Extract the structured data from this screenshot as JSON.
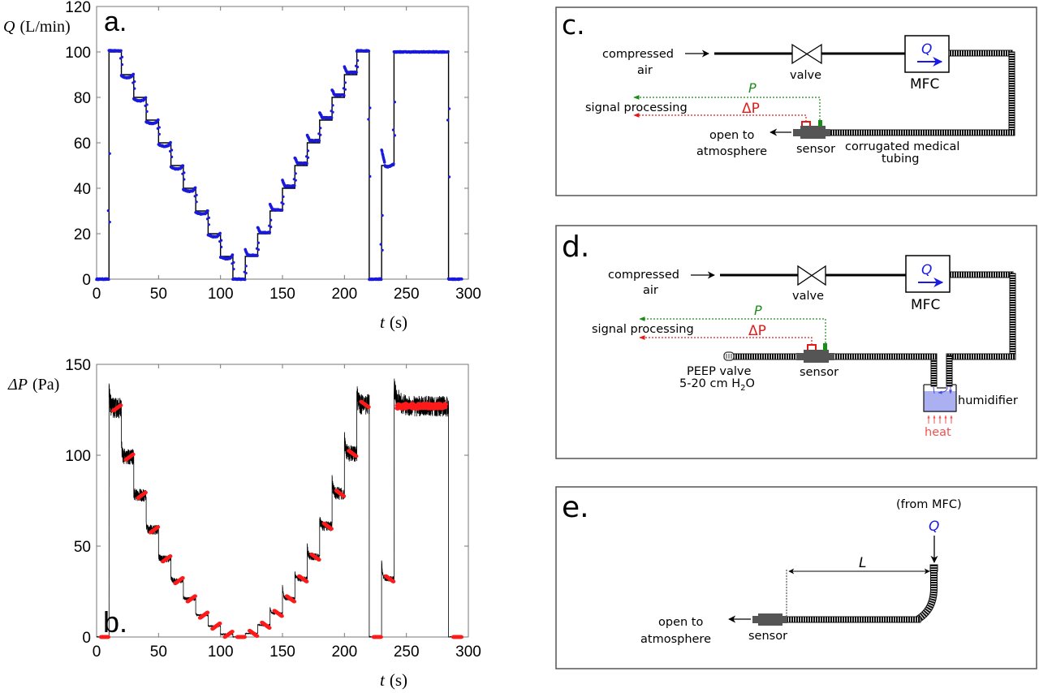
{
  "chart_data": [
    {
      "panel_label": "a.",
      "type": "line",
      "ylabel": "Q (L/min)",
      "ylabel_var": "Q",
      "ylabel_unit": "(L/min)",
      "xlabel_var": "t",
      "xlabel_unit": "(s)",
      "xlim": [
        0,
        300
      ],
      "ylim": [
        0,
        120
      ],
      "xticks": [
        "0",
        "50",
        "100",
        "150",
        "200",
        "250",
        "300"
      ],
      "yticks": [
        "0",
        "20",
        "40",
        "60",
        "80",
        "100",
        "120"
      ],
      "xtick_values": [
        0,
        50,
        100,
        150,
        200,
        250,
        300
      ],
      "ytick_values": [
        0,
        20,
        40,
        60,
        80,
        100,
        120
      ],
      "grid": false,
      "series": [
        {
          "name": "setpoint",
          "color": "#000000",
          "style": "step-line",
          "steps": [
            [
              0,
              0
            ],
            [
              10,
              100
            ],
            [
              20,
              90
            ],
            [
              30,
              80
            ],
            [
              40,
              70
            ],
            [
              50,
              60
            ],
            [
              60,
              50
            ],
            [
              70,
              40
            ],
            [
              80,
              30
            ],
            [
              90,
              20
            ],
            [
              100,
              10
            ],
            [
              110,
              0
            ],
            [
              120,
              10
            ],
            [
              130,
              20
            ],
            [
              140,
              30
            ],
            [
              150,
              40
            ],
            [
              160,
              50
            ],
            [
              170,
              60
            ],
            [
              180,
              70
            ],
            [
              190,
              80
            ],
            [
              200,
              90
            ],
            [
              210,
              100
            ],
            [
              220,
              0
            ],
            [
              230,
              50
            ],
            [
              240,
              100
            ],
            [
              284,
              0
            ],
            [
              295,
              0
            ]
          ]
        },
        {
          "name": "measured",
          "color": "#1a1adc",
          "style": "markers",
          "plateaus": [
            {
              "t0": 0,
              "t1": 10,
              "v": 0
            },
            {
              "t0": 10,
              "t1": 20,
              "v": 100.5
            },
            {
              "t0": 20,
              "t1": 30,
              "v": 89.5
            },
            {
              "t0": 30,
              "t1": 40,
              "v": 79.3
            },
            {
              "t0": 40,
              "t1": 50,
              "v": 69.3
            },
            {
              "t0": 50,
              "t1": 60,
              "v": 59.3
            },
            {
              "t0": 60,
              "t1": 70,
              "v": 49.3
            },
            {
              "t0": 70,
              "t1": 80,
              "v": 39.5
            },
            {
              "t0": 80,
              "t1": 90,
              "v": 29.5
            },
            {
              "t0": 90,
              "t1": 100,
              "v": 19.5
            },
            {
              "t0": 100,
              "t1": 110,
              "v": 9.8
            },
            {
              "t0": 110,
              "t1": 120,
              "v": 0
            },
            {
              "t0": 120,
              "t1": 130,
              "v": 10.5
            },
            {
              "t0": 130,
              "t1": 140,
              "v": 20.5
            },
            {
              "t0": 140,
              "t1": 150,
              "v": 30.5
            },
            {
              "t0": 150,
              "t1": 160,
              "v": 41
            },
            {
              "t0": 160,
              "t1": 170,
              "v": 51
            },
            {
              "t0": 170,
              "t1": 180,
              "v": 61
            },
            {
              "t0": 180,
              "t1": 190,
              "v": 71
            },
            {
              "t0": 190,
              "t1": 200,
              "v": 81
            },
            {
              "t0": 200,
              "t1": 210,
              "v": 91
            },
            {
              "t0": 210,
              "t1": 220,
              "v": 100.5
            },
            {
              "t0": 220,
              "t1": 230,
              "v": 0
            },
            {
              "t0": 230,
              "t1": 240,
              "v": 51
            },
            {
              "t0": 240,
              "t1": 284,
              "v": 100
            },
            {
              "t0": 284,
              "t1": 295,
              "v": 0
            }
          ]
        }
      ]
    },
    {
      "panel_label": "b.",
      "type": "line",
      "ylabel": "ΔP (Pa)",
      "ylabel_var": "ΔP",
      "ylabel_unit": "(Pa)",
      "xlabel_var": "t",
      "xlabel_unit": "(s)",
      "xlim": [
        0,
        300
      ],
      "ylim": [
        0,
        150
      ],
      "xticks": [
        "0",
        "50",
        "100",
        "150",
        "200",
        "250",
        "300"
      ],
      "yticks": [
        "0",
        "50",
        "100",
        "150"
      ],
      "xtick_values": [
        0,
        50,
        100,
        150,
        200,
        250,
        300
      ],
      "ytick_values": [
        0,
        50,
        100,
        150
      ],
      "grid": false,
      "series": [
        {
          "name": "raw",
          "color": "#000000",
          "style": "noisy-line",
          "plateaus": [
            {
              "t0": 0,
              "t1": 10,
              "v": 0,
              "peak": 0
            },
            {
              "t0": 10,
              "t1": 20,
              "v": 126,
              "peak": 137
            },
            {
              "t0": 20,
              "t1": 30,
              "v": 99,
              "peak": 106
            },
            {
              "t0": 30,
              "t1": 40,
              "v": 78,
              "peak": 80
            },
            {
              "t0": 40,
              "t1": 50,
              "v": 59,
              "peak": 62
            },
            {
              "t0": 50,
              "t1": 60,
              "v": 43,
              "peak": 45
            },
            {
              "t0": 60,
              "t1": 70,
              "v": 31,
              "peak": 33
            },
            {
              "t0": 70,
              "t1": 80,
              "v": 21,
              "peak": 22
            },
            {
              "t0": 80,
              "t1": 90,
              "v": 12,
              "peak": 13
            },
            {
              "t0": 90,
              "t1": 100,
              "v": 6,
              "peak": 6
            },
            {
              "t0": 100,
              "t1": 110,
              "v": 1.5,
              "peak": 1.5
            },
            {
              "t0": 110,
              "t1": 120,
              "v": 0,
              "peak": 0
            },
            {
              "t0": 120,
              "t1": 130,
              "v": 2,
              "peak": 2
            },
            {
              "t0": 130,
              "t1": 140,
              "v": 6.5,
              "peak": 7
            },
            {
              "t0": 140,
              "t1": 150,
              "v": 13,
              "peak": 16
            },
            {
              "t0": 150,
              "t1": 160,
              "v": 21,
              "peak": 28
            },
            {
              "t0": 160,
              "t1": 170,
              "v": 32,
              "peak": 35
            },
            {
              "t0": 170,
              "t1": 180,
              "v": 44,
              "peak": 50
            },
            {
              "t0": 180,
              "t1": 190,
              "v": 61,
              "peak": 65
            },
            {
              "t0": 190,
              "t1": 200,
              "v": 79,
              "peak": 88
            },
            {
              "t0": 200,
              "t1": 210,
              "v": 101,
              "peak": 110
            },
            {
              "t0": 210,
              "t1": 220,
              "v": 128,
              "peak": 136
            },
            {
              "t0": 220,
              "t1": 230,
              "v": 0,
              "peak": 0
            },
            {
              "t0": 230,
              "t1": 240,
              "v": 32,
              "peak": 42
            },
            {
              "t0": 240,
              "t1": 284,
              "v": 127,
              "peak": 138
            },
            {
              "t0": 284,
              "t1": 295,
              "v": 0,
              "peak": 0
            }
          ]
        },
        {
          "name": "filtered",
          "color": "#ff1a1a",
          "style": "markers"
        }
      ]
    }
  ],
  "diagrams": {
    "c": {
      "label": "c.",
      "compressed_air": "compressed",
      "air": "air",
      "valve": "valve",
      "mfc": "MFC",
      "q": "Q",
      "p": "P",
      "dp": "ΔP",
      "signal_processing": "signal processing",
      "open_to": "open to",
      "atmosphere": "atmosphere",
      "sensor": "sensor",
      "tubing_line1": "corrugated medical",
      "tubing_line2": "tubing"
    },
    "d": {
      "label": "d.",
      "compressed_air": "compressed",
      "air": "air",
      "valve": "valve",
      "mfc": "MFC",
      "q": "Q",
      "p": "P",
      "dp": "ΔP",
      "signal_processing": "signal processing",
      "peep_line1": "PEEP valve",
      "peep_line2_prefix": "5-20 cm H",
      "peep_sub": "2",
      "peep_suffix": "O",
      "sensor": "sensor",
      "humidifier": "humidifier",
      "heat": "heat"
    },
    "e": {
      "label": "e.",
      "from_mfc": "(from MFC)",
      "q": "Q",
      "l": "L",
      "open_to": "open to",
      "atmosphere": "atmosphere",
      "sensor": "sensor"
    },
    "colors": {
      "green": "#1a8c1a",
      "red": "#e61919",
      "blue": "#1a1ae6",
      "sensor_gray": "#555555",
      "water": "#aab0f0",
      "heat": "#f05050"
    }
  }
}
